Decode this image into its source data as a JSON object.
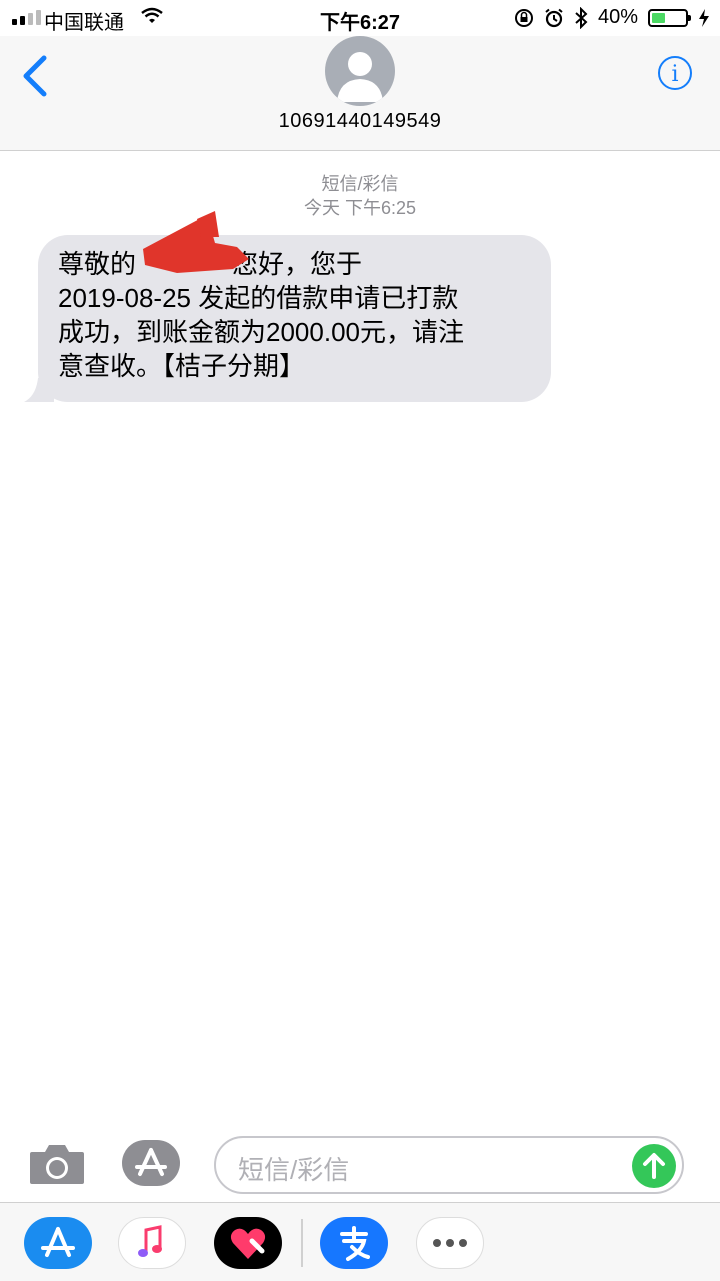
{
  "status_bar": {
    "carrier": "中国联通",
    "time": "下午6:27",
    "battery": "40%",
    "battery_level": 0.4
  },
  "header": {
    "contact": "10691440149549"
  },
  "conversation": {
    "service": "短信/彩信",
    "timestamp": "今天 下午6:25",
    "message": {
      "part1": "尊敬的",
      "part2": "您好，您于",
      "line2": "2019-08-25 发起的借款申请已打款",
      "line3": "成功，到账金额为2000.00元，请注",
      "line4": "意查收。【桔子分期】"
    }
  },
  "input": {
    "placeholder": "短信/彩信"
  },
  "app_drawer": {
    "apps": [
      "app-store",
      "music",
      "digital-touch",
      "alipay",
      "more"
    ]
  },
  "colors": {
    "accent": "#147efb",
    "bubble": "#e5e5ea",
    "send": "#34c759",
    "alipay": "#1677ff",
    "redaction": "#e0352b"
  }
}
